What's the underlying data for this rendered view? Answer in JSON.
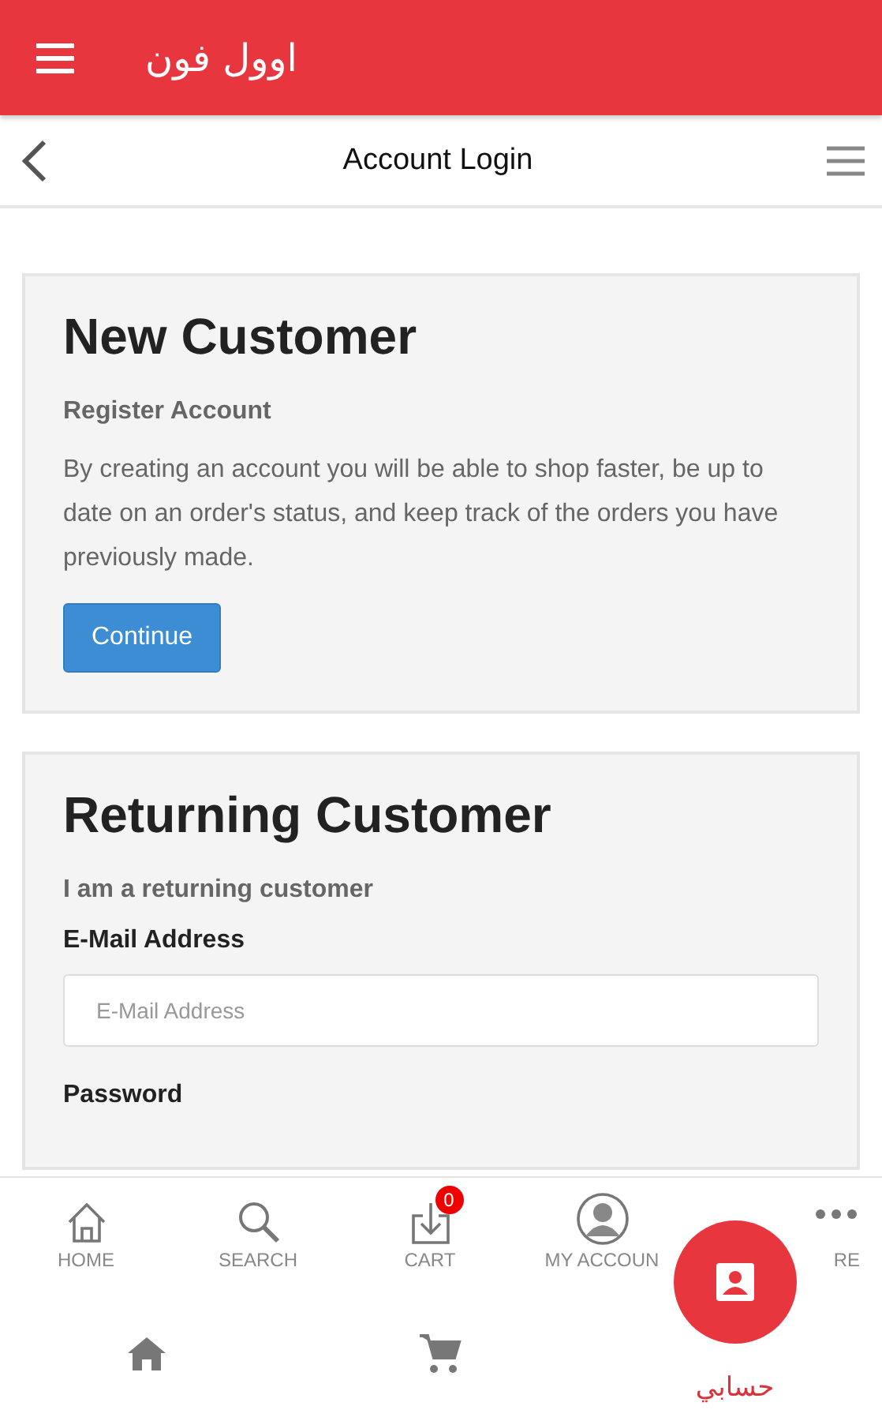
{
  "app_bar": {
    "title": "اوول فون"
  },
  "page_header": {
    "title": "Account Login"
  },
  "new_customer": {
    "heading": "New Customer",
    "subheading": "Register Account",
    "text": "By creating an account you will be able to shop faster, be up to date on an order's status, and keep track of the orders you have previously made.",
    "button": "Continue"
  },
  "returning_customer": {
    "heading": "Returning Customer",
    "subheading": "I am a returning customer",
    "fields": [
      {
        "label": "E-Mail Address",
        "placeholder": "E-Mail Address"
      },
      {
        "label": "Password"
      }
    ]
  },
  "web_nav": [
    {
      "kind": "home",
      "label": "HOME"
    },
    {
      "kind": "search",
      "label": "SEARCH"
    },
    {
      "kind": "cart",
      "label": "CART",
      "badge": "0"
    },
    {
      "kind": "account",
      "label": "MY ACCOUN"
    },
    {
      "kind": "more",
      "label": "RE"
    }
  ],
  "bottom_bar": [
    {
      "kind": "home",
      "selected": false
    },
    {
      "kind": "cart",
      "selected": false
    },
    {
      "kind": "account",
      "selected": true,
      "label": "حسابي"
    }
  ]
}
